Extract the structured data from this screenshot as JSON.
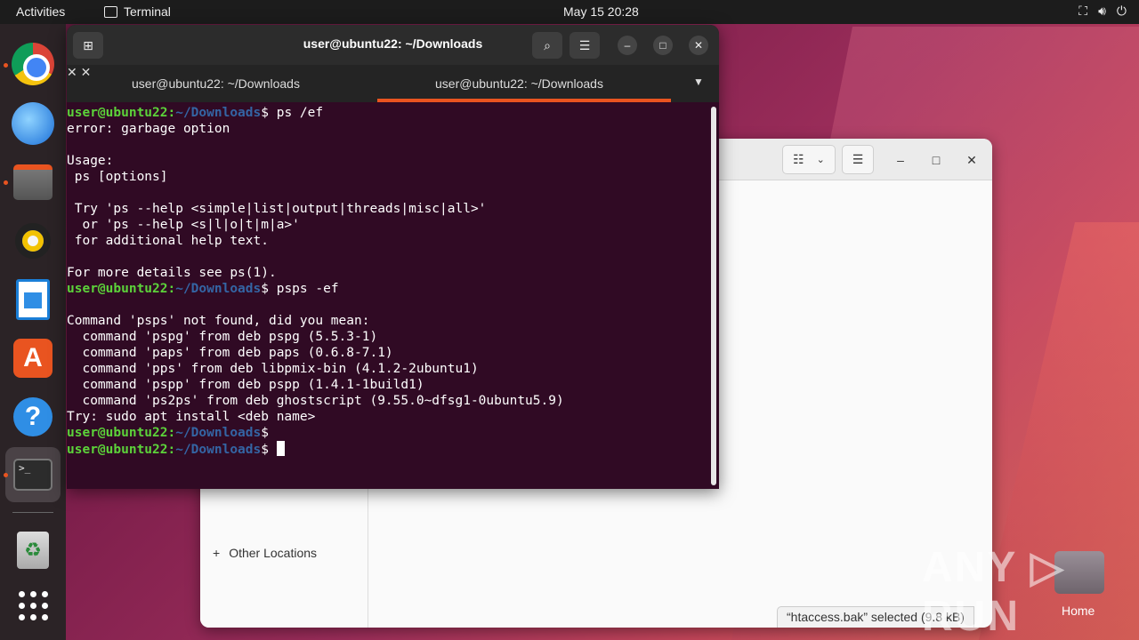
{
  "topbar": {
    "activities": "Activities",
    "app_name": "Terminal",
    "clock": "May 15  20:28"
  },
  "dock": {
    "items": [
      "google-chrome",
      "thunderbird",
      "files",
      "rhythmbox",
      "libreoffice-writer",
      "app-center",
      "help",
      "terminal",
      "trash",
      "show-apps"
    ],
    "terminal_glyph": ">_"
  },
  "terminal": {
    "title": "user@ubuntu22: ~/Downloads",
    "tabs": [
      {
        "label": "user@ubuntu22: ~/Downloads",
        "active": false
      },
      {
        "label": "user@ubuntu22: ~/Downloads",
        "active": true
      }
    ],
    "prompt_user": "user@ubuntu22",
    "prompt_path": "~/Downloads",
    "lines": [
      {
        "type": "prompt",
        "cmd": " ps /ef"
      },
      {
        "type": "out",
        "text": "error: garbage option"
      },
      {
        "type": "out",
        "text": ""
      },
      {
        "type": "out",
        "text": "Usage:"
      },
      {
        "type": "out",
        "text": " ps [options]"
      },
      {
        "type": "out",
        "text": ""
      },
      {
        "type": "out",
        "text": " Try 'ps --help <simple|list|output|threads|misc|all>'"
      },
      {
        "type": "out",
        "text": "  or 'ps --help <s|l|o|t|m|a>'"
      },
      {
        "type": "out",
        "text": " for additional help text."
      },
      {
        "type": "out",
        "text": ""
      },
      {
        "type": "out",
        "text": "For more details see ps(1)."
      },
      {
        "type": "prompt",
        "cmd": " psps -ef"
      },
      {
        "type": "out",
        "text": ""
      },
      {
        "type": "out",
        "text": "Command 'psps' not found, did you mean:"
      },
      {
        "type": "out",
        "text": "  command 'pspg' from deb pspg (5.5.3-1)"
      },
      {
        "type": "out",
        "text": "  command 'paps' from deb paps (0.6.8-7.1)"
      },
      {
        "type": "out",
        "text": "  command 'pps' from deb libpmix-bin (4.1.2-2ubuntu1)"
      },
      {
        "type": "out",
        "text": "  command 'pspp' from deb pspp (1.4.1-1build1)"
      },
      {
        "type": "out",
        "text": "  command 'ps2ps' from deb ghostscript (9.55.0~dfsg1-0ubuntu5.9)"
      },
      {
        "type": "out",
        "text": "Try: sudo apt install <deb name>"
      },
      {
        "type": "prompt",
        "cmd": ""
      },
      {
        "type": "prompt",
        "cmd": " ",
        "cursor": true
      }
    ]
  },
  "file_manager": {
    "sidebar_other": "Other Locations",
    "status": "“htaccess.bak” selected  (9.8 kB)"
  },
  "desktop": {
    "home_label": "Home",
    "watermark": "ANY RUN"
  },
  "colors": {
    "terminal_bg": "#300a24",
    "prompt_user": "#5cd33a",
    "prompt_path": "#3465a4",
    "accent": "#e95420"
  }
}
